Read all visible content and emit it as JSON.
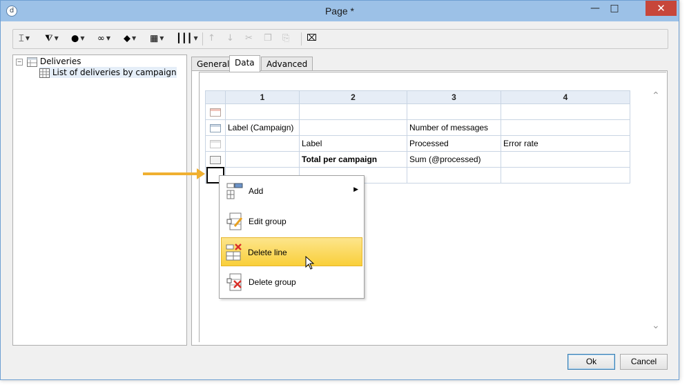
{
  "window": {
    "title": "Page *",
    "minimize": "—",
    "maximize": "□",
    "close": "✕"
  },
  "toolbar": {
    "items": [
      {
        "name": "text-cursor-icon",
        "glyph": "⌶",
        "dropdown": true,
        "disabled": false
      },
      {
        "name": "filter-settings-icon",
        "glyph": "⧨",
        "dropdown": true,
        "disabled": false
      },
      {
        "name": "globe-icon",
        "glyph": "●",
        "dropdown": true,
        "disabled": false
      },
      {
        "name": "link-icon",
        "glyph": "∞",
        "dropdown": true,
        "disabled": false
      },
      {
        "name": "layers-icon",
        "glyph": "◆",
        "dropdown": true,
        "disabled": false
      },
      {
        "name": "table-icon",
        "glyph": "▦",
        "dropdown": true,
        "disabled": false
      },
      {
        "name": "columns-icon",
        "glyph": "┃┃┃",
        "dropdown": true,
        "disabled": false
      },
      {
        "name": "move-up-icon",
        "glyph": "↑",
        "dropdown": false,
        "disabled": true
      },
      {
        "name": "move-down-icon",
        "glyph": "↓",
        "dropdown": false,
        "disabled": true
      },
      {
        "name": "cut-icon",
        "glyph": "✂",
        "dropdown": false,
        "disabled": true
      },
      {
        "name": "copy-icon",
        "glyph": "❐",
        "dropdown": false,
        "disabled": true
      },
      {
        "name": "paste-icon",
        "glyph": "⎘",
        "dropdown": false,
        "disabled": true
      },
      {
        "name": "delete-icon",
        "glyph": "⌧",
        "dropdown": false,
        "disabled": false
      }
    ]
  },
  "tree": {
    "root": {
      "label": "Deliveries",
      "expander": "−"
    },
    "child": {
      "label": "List of deliveries by campaign"
    }
  },
  "tabs": [
    {
      "label": "General",
      "active": false
    },
    {
      "label": "Data",
      "active": true
    },
    {
      "label": "Advanced",
      "active": false
    }
  ],
  "grid": {
    "headers": [
      "1",
      "2",
      "3",
      "4"
    ],
    "rows": [
      {
        "type": "header-row",
        "cells": [
          "",
          "",
          "",
          ""
        ]
      },
      {
        "type": "group",
        "cells": [
          "Label (Campaign)",
          "",
          "Number of messages",
          ""
        ]
      },
      {
        "type": "plain",
        "cells": [
          "",
          "Label",
          "Processed",
          "Error rate"
        ]
      },
      {
        "type": "total",
        "cells": [
          "",
          "Total per campaign",
          "Sum (@processed)",
          ""
        ]
      },
      {
        "type": "selected",
        "cells": [
          "",
          "",
          "",
          ""
        ]
      }
    ]
  },
  "context_menu": {
    "items": [
      {
        "label": "Add",
        "submenu": true,
        "highlighted": false,
        "icon": "add-line-icon"
      },
      {
        "label": "Edit group",
        "submenu": false,
        "highlighted": false,
        "icon": "edit-group-icon"
      },
      {
        "label": "Delete line",
        "submenu": false,
        "highlighted": true,
        "icon": "delete-line-icon"
      },
      {
        "label": "Delete group",
        "submenu": false,
        "highlighted": false,
        "icon": "delete-group-icon"
      }
    ]
  },
  "buttons": {
    "ok": {
      "label": "Ok"
    },
    "cancel": {
      "label": "Cancel"
    }
  },
  "colors": {
    "titlebar": "#9cc1e7",
    "close": "#c7463a",
    "highlight": "#f9cf3a",
    "callout_arrow": "#f0b030"
  }
}
